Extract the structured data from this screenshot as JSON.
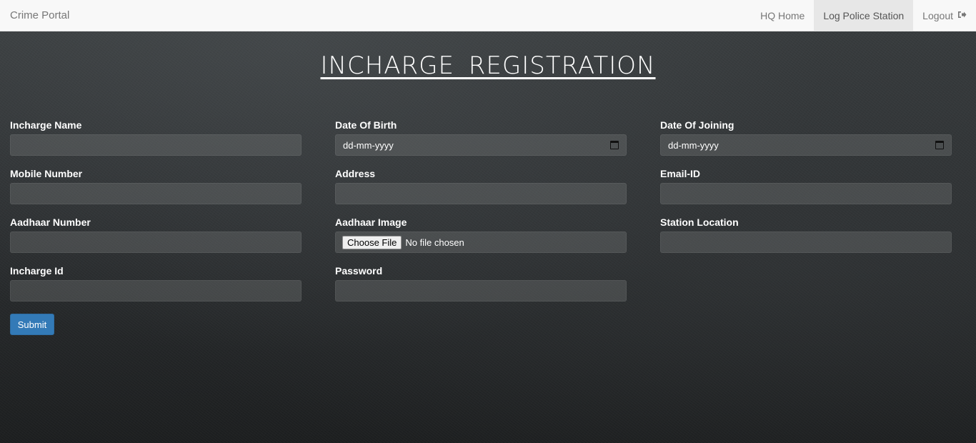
{
  "navbar": {
    "brand": "Crime Portal",
    "links": [
      {
        "label": "HQ Home",
        "active": false
      },
      {
        "label": "Log Police Station",
        "active": true
      },
      {
        "label": "Logout",
        "active": false,
        "icon": "logout-icon"
      }
    ]
  },
  "page": {
    "title": "INCHARGE REGISTRATION"
  },
  "form": {
    "fields": [
      {
        "label": "Incharge Name",
        "value": ""
      },
      {
        "label": "Date Of Birth",
        "value": "dd-mm-yyyy",
        "icon": "calendar-icon"
      },
      {
        "label": "Date Of Joining",
        "value": "dd-mm-yyyy",
        "icon": "calendar-icon"
      },
      {
        "label": "Mobile Number",
        "value": ""
      },
      {
        "label": "Address",
        "value": ""
      },
      {
        "label": "Email-ID",
        "value": ""
      },
      {
        "label": "Aadhaar Number",
        "value": ""
      },
      {
        "label": "Aadhaar Image",
        "button": "Choose File",
        "value": "No file chosen"
      },
      {
        "label": "Station Location",
        "value": ""
      },
      {
        "label": "Incharge Id",
        "value": ""
      },
      {
        "label": "Password",
        "value": ""
      }
    ],
    "submit_label": "Submit"
  },
  "colors": {
    "accent": "#337ab7",
    "navbar_bg": "#f8f8f8",
    "active_nav_bg": "#e7e7e7"
  }
}
